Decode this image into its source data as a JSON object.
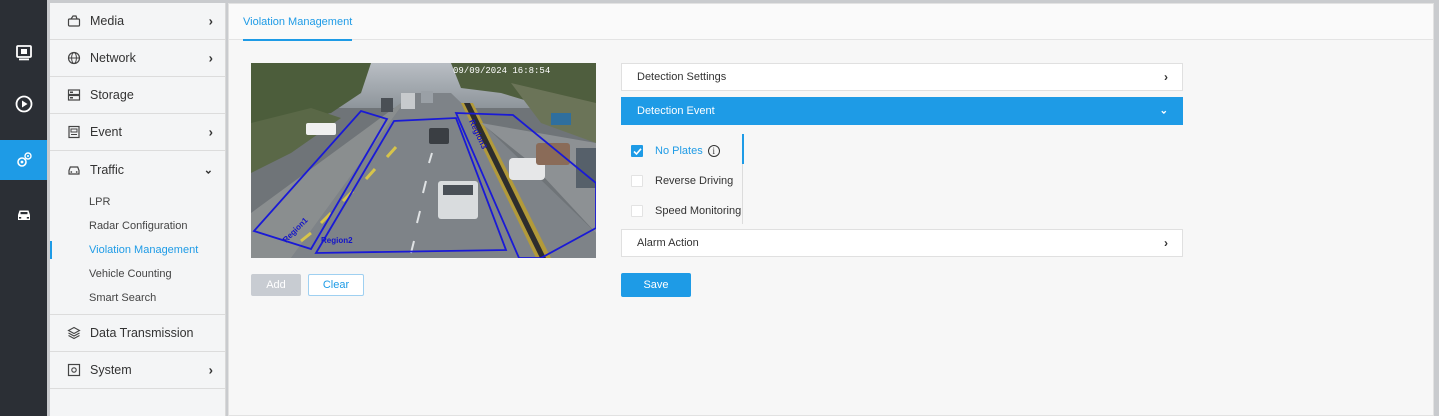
{
  "rail": {
    "items": [
      {
        "icon": "monitor-icon",
        "active": false
      },
      {
        "icon": "playback-icon",
        "active": false
      },
      {
        "icon": "settings-gear-icon",
        "active": true
      },
      {
        "icon": "car-icon",
        "active": false
      }
    ]
  },
  "sidebar": {
    "media": "Media",
    "network": "Network",
    "storage": "Storage",
    "event": "Event",
    "traffic": "Traffic",
    "traffic_sub": {
      "lpr": "LPR",
      "radar": "Radar Configuration",
      "violation": "Violation Management",
      "counting": "Vehicle Counting",
      "smart_search": "Smart Search"
    },
    "data_transmission": "Data Transmission",
    "system": "System"
  },
  "main": {
    "tab": "Violation Management",
    "camera": {
      "timestamp": "09/09/2024 16:8:54",
      "regions": [
        "Region1",
        "Region2",
        "Region3"
      ]
    },
    "add_label": "Add",
    "clear_label": "Clear",
    "sections": {
      "detection_settings": "Detection Settings",
      "detection_event": "Detection Event",
      "alarm_action": "Alarm Action"
    },
    "events": {
      "no_plates": "No Plates",
      "reverse_driving": "Reverse Driving",
      "speed_monitoring": "Speed Monitoring"
    },
    "save_label": "Save"
  },
  "colors": {
    "accent": "#1e9be6",
    "rail": "#2b2f35",
    "region_line": "#1a1ad6"
  }
}
